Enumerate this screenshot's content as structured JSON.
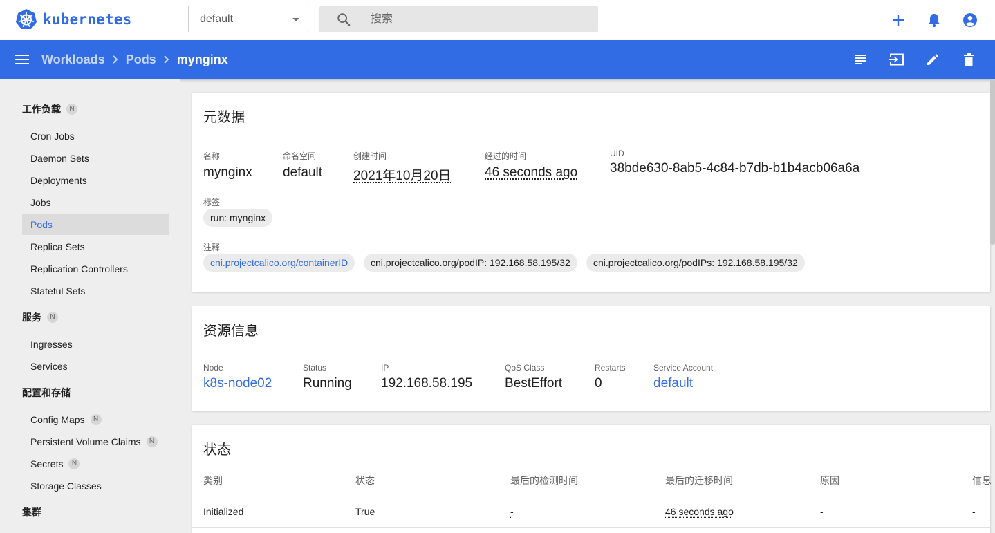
{
  "header": {
    "brand": "kubernetes",
    "namespace_selected": "default",
    "search_placeholder": "搜索",
    "actions": [
      "add-icon",
      "notifications-icon",
      "account-icon"
    ]
  },
  "toolbar": {
    "breadcrumb": [
      "Workloads",
      "Pods"
    ],
    "current": "mynginx",
    "actions": [
      "logs-icon",
      "exec-icon",
      "edit-icon",
      "delete-icon"
    ]
  },
  "sidebar": {
    "workloads_label": "工作负载",
    "workloads_badge": "N",
    "workloads": [
      "Cron Jobs",
      "Daemon Sets",
      "Deployments",
      "Jobs",
      "Pods",
      "Replica Sets",
      "Replication Controllers",
      "Stateful Sets"
    ],
    "active_item": "Pods",
    "service_label": "服务",
    "service_badge": "N",
    "service": [
      "Ingresses",
      "Services"
    ],
    "config_label": "配置和存储",
    "config": [
      {
        "label": "Config Maps",
        "badge": "N"
      },
      {
        "label": "Persistent Volume Claims",
        "badge": "N"
      },
      {
        "label": "Secrets",
        "badge": "N"
      },
      {
        "label": "Storage Classes",
        "badge": ""
      }
    ],
    "cluster_label": "集群"
  },
  "metadata": {
    "title": "元数据",
    "name_label": "名称",
    "name": "mynginx",
    "namespace_label": "命名空间",
    "namespace": "default",
    "created_label": "创建时间",
    "created": "2021年10月20日",
    "age_label": "经过的时间",
    "age": "46 seconds ago",
    "uid_label": "UID",
    "uid": "38bde630-8ab5-4c84-b7db-b1b4acb06a6a",
    "labels_label": "标签",
    "labels": [
      "run: mynginx"
    ],
    "annotations_label": "注释",
    "annotations": [
      "cni.projectcalico.org/containerID",
      "cni.projectcalico.org/podIP: 192.168.58.195/32",
      "cni.projectcalico.org/podIPs: 192.168.58.195/32"
    ]
  },
  "resource": {
    "title": "资源信息",
    "node_label": "Node",
    "node": "k8s-node02",
    "status_label": "Status",
    "status": "Running",
    "ip_label": "IP",
    "ip": "192.168.58.195",
    "qos_label": "QoS Class",
    "qos": "BestEffort",
    "restarts_label": "Restarts",
    "restarts": "0",
    "sa_label": "Service Account",
    "sa": "default"
  },
  "conditions": {
    "title": "状态",
    "columns": [
      "类别",
      "状态",
      "最后的检测时间",
      "最后的迁移时间",
      "原因",
      "信息"
    ],
    "rows": [
      {
        "type": "Initialized",
        "status": "True",
        "probe": "-",
        "transition": "46 seconds ago",
        "reason": "-",
        "message": "-"
      }
    ]
  },
  "colors": {
    "brand": "#326ce5",
    "toolbar": "#326ce5",
    "background": "#eeeeee"
  }
}
